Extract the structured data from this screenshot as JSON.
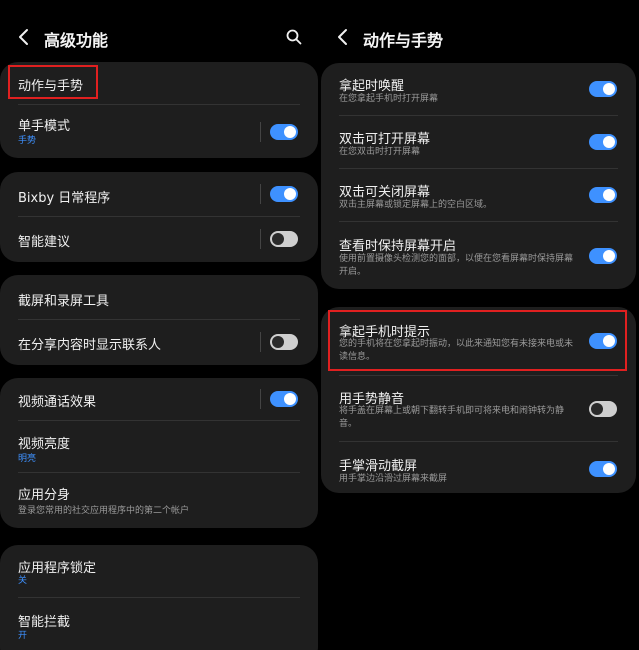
{
  "colors": {
    "accent": "#3e91ff",
    "highlight": "#e02020",
    "card": "#1e1e1e",
    "background": "#000000"
  },
  "icons": {
    "back": "chevron-left-icon",
    "search": "search-icon"
  },
  "left": {
    "title": "高级功能",
    "groups": [
      {
        "items": [
          {
            "label": "动作与手势"
          },
          {
            "label": "单手模式",
            "sub": "手势",
            "toggle": true
          }
        ]
      },
      {
        "items": [
          {
            "label": "Bixby 日常程序",
            "toggle": true
          },
          {
            "label": "智能建议",
            "toggle": false
          }
        ]
      },
      {
        "items": [
          {
            "label": "截屏和录屏工具"
          },
          {
            "label": "在分享内容时显示联系人",
            "toggle": false
          }
        ]
      },
      {
        "items": [
          {
            "label": "视频通话效果",
            "toggle": true
          },
          {
            "label": "视频亮度",
            "sub": "明亮"
          },
          {
            "label": "应用分身",
            "sub": "登录您常用的社交应用程序中的第二个帐户"
          }
        ]
      },
      {
        "items": [
          {
            "label": "应用程序锁定",
            "sub": "关"
          },
          {
            "label": "智能拦截",
            "sub": "开"
          }
        ]
      }
    ]
  },
  "right": {
    "title": "动作与手势",
    "groups": [
      {
        "items": [
          {
            "label": "拿起时唤醒",
            "sub": "在您拿起手机时打开屏幕",
            "toggle": true
          },
          {
            "label": "双击可打开屏幕",
            "sub": "在您双击时打开屏幕",
            "toggle": true
          },
          {
            "label": "双击可关闭屏幕",
            "sub": "双击主屏幕或锁定屏幕上的空白区域。",
            "toggle": true
          },
          {
            "label": "查看时保持屏幕开启",
            "sub": "使用前置摄像头检测您的面部，以便在您看屏幕时保持屏幕开启。",
            "toggle": true
          }
        ]
      },
      {
        "items": [
          {
            "label": "拿起手机时提示",
            "sub": "您的手机将在您拿起时振动，以此来通知您有未接来电或未读信息。",
            "toggle": true
          },
          {
            "label": "用手势静音",
            "sub": "将手盖在屏幕上或朝下翻转手机即可将来电和闹钟转为静音。",
            "toggle": false
          },
          {
            "label": "手掌滑动截屏",
            "sub": "用手掌边沿滑过屏幕来截屏",
            "toggle": true
          }
        ]
      }
    ]
  }
}
